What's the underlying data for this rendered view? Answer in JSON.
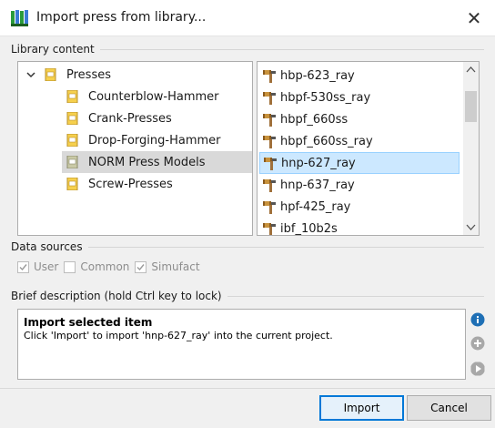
{
  "window": {
    "title": "Import press from library...",
    "close_glyph": "✕"
  },
  "library": {
    "label": "Library content",
    "tree": {
      "root": "Presses",
      "children": [
        "Counterblow-Hammer",
        "Crank-Presses",
        "Drop-Forging-Hammer",
        "NORM Press Models",
        "Screw-Presses"
      ],
      "selected_index": 3
    },
    "list": {
      "items": [
        "hbp-623_ray",
        "hbpf-530ss_ray",
        "hbpf_660ss",
        "hbpf_660ss_ray",
        "hnp-627_ray",
        "hnp-637_ray",
        "hpf-425_ray",
        "ibf_10b2s"
      ],
      "selected_index": 4
    }
  },
  "data_sources": {
    "label": "Data sources",
    "options": [
      {
        "label": "User",
        "checked": true
      },
      {
        "label": "Common",
        "checked": false
      },
      {
        "label": "Simufact",
        "checked": true
      }
    ]
  },
  "description": {
    "label": "Brief description (hold Ctrl key to lock)",
    "heading": "Import selected item",
    "body": "Click 'Import' to import 'hnp-627_ray' into the current project."
  },
  "buttons": {
    "import": "Import",
    "cancel": "Cancel"
  },
  "icons": {
    "app": "library-books-icon",
    "folder": "document-icon",
    "item": "hammer-icon",
    "side": [
      "info-icon",
      "add-icon",
      "play-icon"
    ]
  },
  "colors": {
    "selection_list": "#cce8ff",
    "selection_tree": "#d9d9d9",
    "primary_border": "#0078d7",
    "info_blue": "#1e6fb5"
  }
}
